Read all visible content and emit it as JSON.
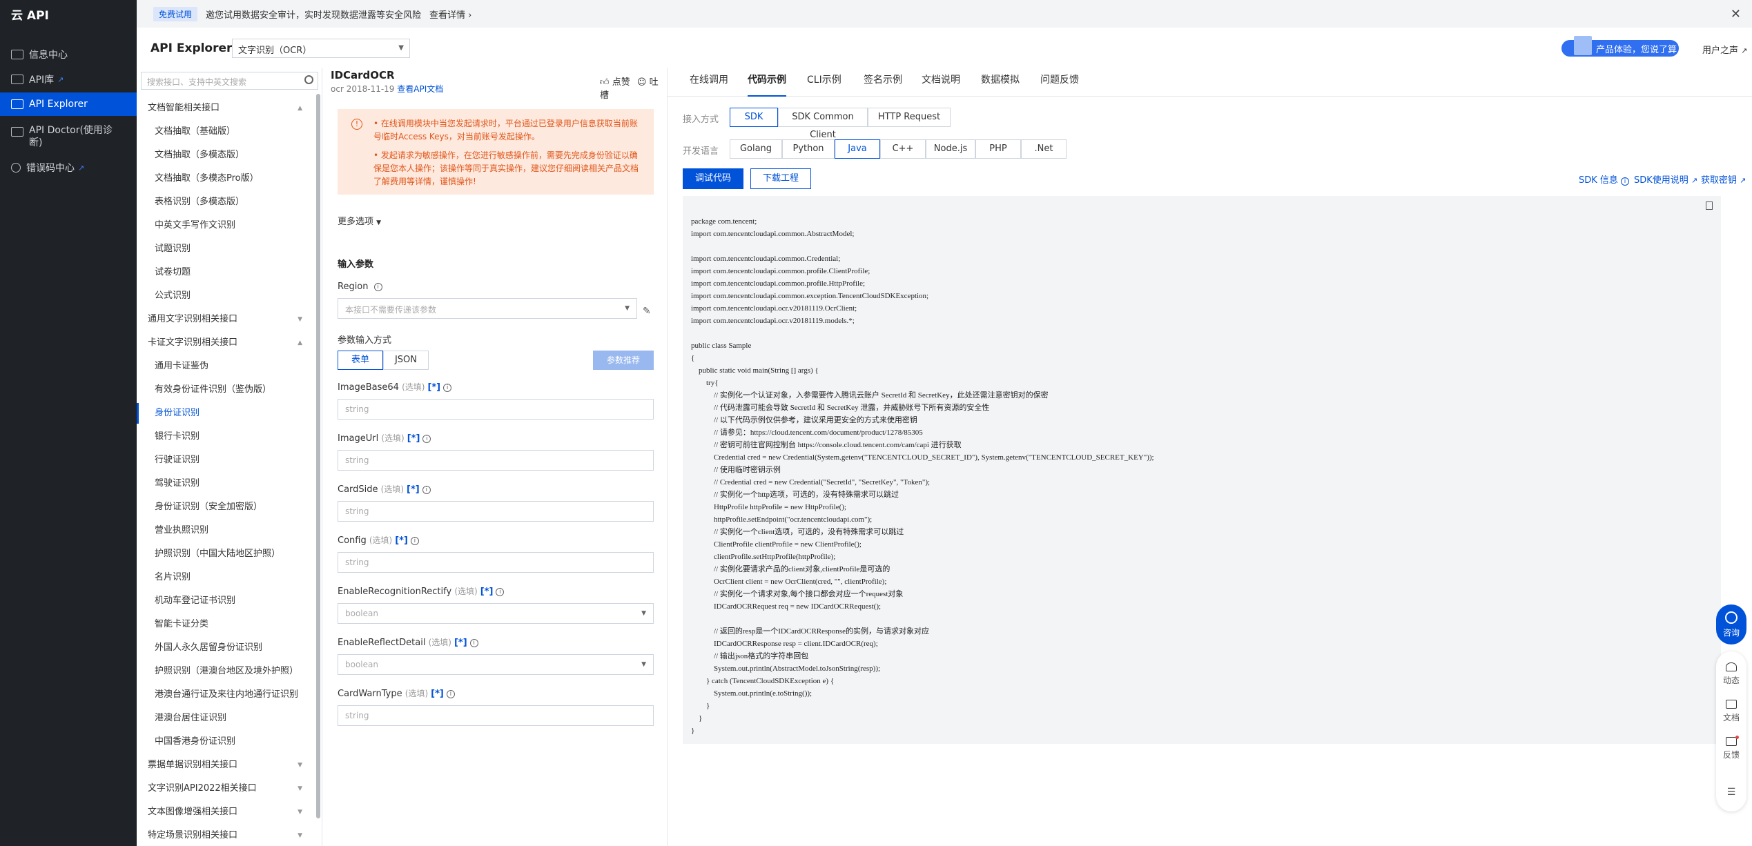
{
  "sidebar": {
    "brand": "云 API",
    "items": [
      {
        "label": "信息中心",
        "active": false,
        "external": false,
        "icon": "grid-icon"
      },
      {
        "label": "API库",
        "active": false,
        "external": true,
        "icon": "library-icon"
      },
      {
        "label": "API Explorer",
        "active": true,
        "external": false,
        "icon": "explorer-icon"
      },
      {
        "label": "API Doctor(使用诊断)",
        "active": false,
        "external": false,
        "icon": "doctor-icon"
      },
      {
        "label": "错误码中心",
        "active": false,
        "external": true,
        "icon": "error-code-icon"
      }
    ]
  },
  "banner": {
    "badge": "免费试用",
    "message": "邀您试用数据安全审计，实时发现数据泄露等安全风险",
    "link": "查看详情",
    "close": "✕"
  },
  "header": {
    "title": "API Explorer",
    "product_select": "文字识别（OCR）",
    "promo": "产品体验，您说了算",
    "user_link": "用户之声"
  },
  "tree": {
    "search_placeholder": "搜索接口、支持中英文搜索",
    "items": [
      {
        "label": "文档智能相关接口",
        "type": "group",
        "expanded": true
      },
      {
        "label": "文档抽取（基础版）",
        "type": "child"
      },
      {
        "label": "文档抽取（多模态版）",
        "type": "child"
      },
      {
        "label": "文档抽取（多模态Pro版）",
        "type": "child"
      },
      {
        "label": "表格识别（多模态版）",
        "type": "child"
      },
      {
        "label": "中英文手写作文识别",
        "type": "child"
      },
      {
        "label": "试题识别",
        "type": "child"
      },
      {
        "label": "试卷切题",
        "type": "child"
      },
      {
        "label": "公式识别",
        "type": "child"
      },
      {
        "label": "通用文字识别相关接口",
        "type": "group",
        "expanded": false
      },
      {
        "label": "卡证文字识别相关接口",
        "type": "group",
        "expanded": true
      },
      {
        "label": "通用卡证鉴伪",
        "type": "child"
      },
      {
        "label": "有效身份证件识别（鉴伪版）",
        "type": "child"
      },
      {
        "label": "身份证识别",
        "type": "child",
        "current": true
      },
      {
        "label": "银行卡识别",
        "type": "child"
      },
      {
        "label": "行驶证识别",
        "type": "child"
      },
      {
        "label": "驾驶证识别",
        "type": "child"
      },
      {
        "label": "身份证识别（安全加密版）",
        "type": "child"
      },
      {
        "label": "营业执照识别",
        "type": "child"
      },
      {
        "label": "护照识别（中国大陆地区护照）",
        "type": "child"
      },
      {
        "label": "名片识别",
        "type": "child"
      },
      {
        "label": "机动车登记证书识别",
        "type": "child"
      },
      {
        "label": "智能卡证分类",
        "type": "child"
      },
      {
        "label": "外国人永久居留身份证识别",
        "type": "child"
      },
      {
        "label": "护照识别（港澳台地区及境外护照）",
        "type": "child"
      },
      {
        "label": "港澳台通行证及来往内地通行证识别",
        "type": "child"
      },
      {
        "label": "港澳台居住证识别",
        "type": "child"
      },
      {
        "label": "中国香港身份证识别",
        "type": "child"
      },
      {
        "label": "票据单据识别相关接口",
        "type": "group",
        "expanded": false
      },
      {
        "label": "文字识别API2022相关接口",
        "type": "group",
        "expanded": false
      },
      {
        "label": "文本图像增强相关接口",
        "type": "group",
        "expanded": false
      },
      {
        "label": "特定场景识别相关接口",
        "type": "group",
        "expanded": false
      }
    ]
  },
  "params": {
    "api_name": "IDCardOCR",
    "api_meta": "ocr 2018-11-19",
    "doc_link": "查看API文档",
    "like": "点赞",
    "complain": "吐槽",
    "notice": [
      "在线调用模块中当您发起请求时，平台通过已登录用户信息获取当前账号临时Access Keys，对当前账号发起操作。",
      "发起请求为敏感操作，在您进行敏感操作前，需要先完成身份验证以确保是您本人操作；该操作等同于真实操作，建议您仔细阅读相关产品文档了解费用等详情，谨慎操作!"
    ],
    "more_options": "更多选项",
    "input_section": "输入参数",
    "region_label": "Region",
    "region_placeholder": "本接口不需要传递该参数",
    "mode_label": "参数输入方式",
    "mode_form": "表单",
    "mode_json": "JSON",
    "recommend": "参数推荐",
    "optional": "(选填)",
    "tag": "[*]",
    "fields": [
      {
        "name": "ImageBase64",
        "kind": "text",
        "value": "string"
      },
      {
        "name": "ImageUrl",
        "kind": "text",
        "value": "string"
      },
      {
        "name": "CardSide",
        "kind": "text",
        "value": "string"
      },
      {
        "name": "Config",
        "kind": "text",
        "value": "string"
      },
      {
        "name": "EnableRecognitionRectify",
        "kind": "select",
        "value": "boolean"
      },
      {
        "name": "EnableReflectDetail",
        "kind": "select",
        "value": "boolean"
      },
      {
        "name": "CardWarnType",
        "kind": "text",
        "value": "string"
      }
    ]
  },
  "code": {
    "tabs": [
      "在线调用",
      "代码示例",
      "CLI示例",
      "签名示例",
      "文档说明",
      "数据模拟",
      "问题反馈"
    ],
    "active_tab": 1,
    "access_label": "接入方式",
    "access_options": [
      "SDK",
      "SDK Common Client",
      "HTTP Request"
    ],
    "access_active": 0,
    "lang_label": "开发语言",
    "languages": [
      "Golang",
      "Python",
      "Java",
      "C++",
      "Node.js",
      "PHP",
      ".Net"
    ],
    "lang_active": 2,
    "debug_button": "调试代码",
    "download_button": "下载工程",
    "sdk_info": "SDK 信息",
    "sdk_guide": "SDK使用说明",
    "get_key": "获取密钥",
    "source": "package com.tencent;\nimport com.tencentcloudapi.common.AbstractModel;\n\nimport com.tencentcloudapi.common.Credential;\nimport com.tencentcloudapi.common.profile.ClientProfile;\nimport com.tencentcloudapi.common.profile.HttpProfile;\nimport com.tencentcloudapi.common.exception.TencentCloudSDKException;\nimport com.tencentcloudapi.ocr.v20181119.OcrClient;\nimport com.tencentcloudapi.ocr.v20181119.models.*;\n\npublic class Sample\n{\n    public static void main(String [] args) {\n        try{\n            // 实例化一个认证对象，入参需要传入腾讯云账户 SecretId 和 SecretKey，此处还需注意密钥对的保密\n            // 代码泄露可能会导致 SecretId 和 SecretKey 泄露，并威胁账号下所有资源的安全性\n            // 以下代码示例仅供参考，建议采用更安全的方式来使用密钥\n            // 请参见：https://cloud.tencent.com/document/product/1278/85305\n            // 密钥可前往官网控制台 https://console.cloud.tencent.com/cam/capi 进行获取\n            Credential cred = new Credential(System.getenv(\"TENCENTCLOUD_SECRET_ID\"), System.getenv(\"TENCENTCLOUD_SECRET_KEY\"));\n            // 使用临时密钥示例\n            // Credential cred = new Credential(\"SecretId\", \"SecretKey\", \"Token\");\n            // 实例化一个http选项，可选的，没有特殊需求可以跳过\n            HttpProfile httpProfile = new HttpProfile();\n            httpProfile.setEndpoint(\"ocr.tencentcloudapi.com\");\n            // 实例化一个client选项，可选的，没有特殊需求可以跳过\n            ClientProfile clientProfile = new ClientProfile();\n            clientProfile.setHttpProfile(httpProfile);\n            // 实例化要请求产品的client对象,clientProfile是可选的\n            OcrClient client = new OcrClient(cred, \"\", clientProfile);\n            // 实例化一个请求对象,每个接口都会对应一个request对象\n            IDCardOCRRequest req = new IDCardOCRRequest();\n\n            // 返回的resp是一个IDCardOCRResponse的实例，与请求对象对应\n            IDCardOCRResponse resp = client.IDCardOCR(req);\n            // 输出json格式的字符串回包\n            System.out.println(AbstractModel.toJsonString(resp));\n        } catch (TencentCloudSDKException e) {\n            System.out.println(e.toString());\n        }\n    }\n}"
  },
  "floating": {
    "consult": "咨询",
    "items": [
      "动态",
      "文档",
      "反馈"
    ]
  },
  "colors": {
    "primary": "#0052d9",
    "sidebar_bg": "#1f2327",
    "notice_bg": "#fde9dd",
    "notice_text": "#e1561b"
  }
}
